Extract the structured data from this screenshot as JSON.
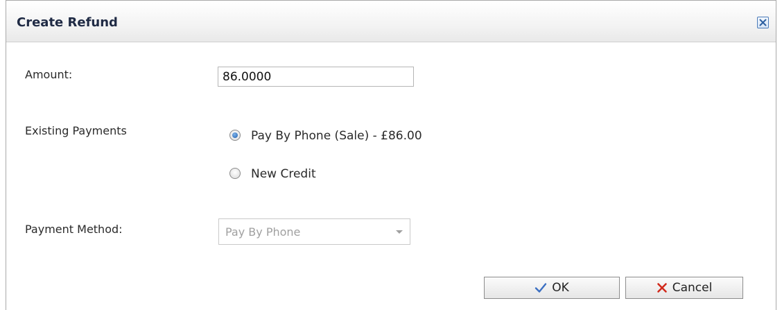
{
  "dialog": {
    "title": "Create Refund"
  },
  "form": {
    "amount_label": "Amount:",
    "amount_value": "86.0000",
    "existing_payments_label": "Existing Payments",
    "payment_options": [
      {
        "label": "Pay By Phone (Sale) - £86.00",
        "selected": true
      },
      {
        "label": "New Credit",
        "selected": false
      }
    ],
    "payment_method_label": "Payment Method:",
    "payment_method_value": "Pay By Phone"
  },
  "buttons": {
    "ok_label": "OK",
    "cancel_label": "Cancel"
  },
  "icons": {
    "close": "close-icon",
    "ok": "checkmark-icon",
    "cancel": "cross-icon",
    "dropdown": "chevron-down-icon"
  },
  "colors": {
    "ok_check": "#3b6fc2",
    "cancel_cross": "#d12a1c",
    "radio_selected": "#1f5fae"
  }
}
